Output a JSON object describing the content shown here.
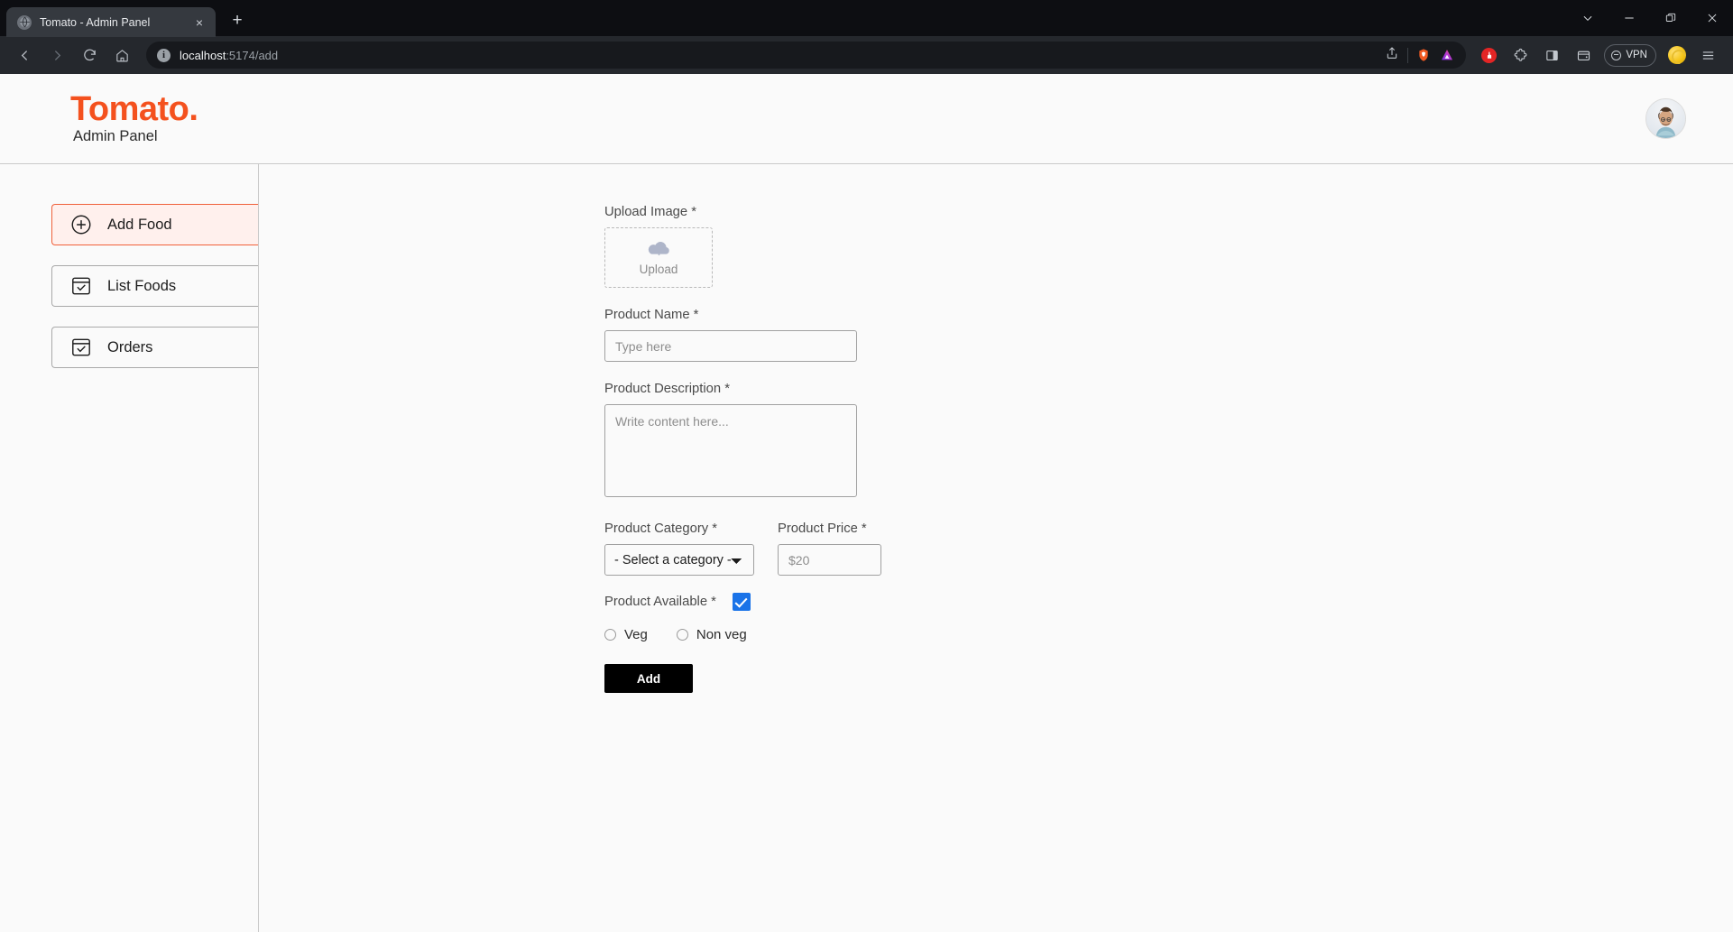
{
  "browser": {
    "tab": {
      "title": "Tomato - Admin Panel",
      "favicon_name": "globe-icon",
      "close_label": "×"
    },
    "new_tab_label": "+",
    "window_controls": [
      "tab-search-chevron",
      "minimize",
      "maximize",
      "close"
    ],
    "nav": {
      "back": "back-arrow",
      "forward": "forward-arrow",
      "reload": "reload-icon",
      "home": "home-icon",
      "bookmark": "bookmark-icon"
    },
    "url": {
      "host": "localhost",
      "path": ":5174/add",
      "full": "localhost:5174/add",
      "info_glyph": "i"
    },
    "url_actions": [
      "share-icon",
      "brave-shields-lion-icon",
      "brave-leo-ai-icon"
    ],
    "toolbar_icons": [
      "brave-rewards-icon",
      "extensions-puzzle-icon",
      "sidebar-panel-icon",
      "brave-wallet-icon"
    ],
    "vpn": {
      "label": "VPN"
    },
    "profile_icon": "browser-profile-avatar",
    "menu_icon": "hamburger-menu-icon"
  },
  "app": {
    "logo": {
      "text": "Tomato.",
      "color": "#f4511e"
    },
    "subtitle": "Admin Panel",
    "avatar_name": "admin-profile-avatar"
  },
  "sidebar": {
    "items": [
      {
        "label": "Add Food",
        "icon": "plus-circle-icon",
        "active": true
      },
      {
        "label": "List Foods",
        "icon": "checkbox-list-icon",
        "active": false
      },
      {
        "label": "Orders",
        "icon": "checkbox-list-icon",
        "active": false
      }
    ],
    "active_colors": {
      "border": "#f0603a",
      "background": "#fff0ed"
    }
  },
  "form": {
    "upload": {
      "label": "Upload Image *",
      "button_text": "Upload",
      "icon": "cloud-upload-icon"
    },
    "product_name": {
      "label": "Product Name *",
      "placeholder": "Type here",
      "value": ""
    },
    "product_description": {
      "label": "Product Description *",
      "placeholder": "Write content here...",
      "value": ""
    },
    "product_category": {
      "label": "Product Category *",
      "selected": "- Select a category -",
      "options": [
        "- Select a category -"
      ]
    },
    "product_price": {
      "label": "Product Price *",
      "placeholder": "$20",
      "value": ""
    },
    "product_available": {
      "label": "Product Available *",
      "checked": true,
      "checkbox_color": "#1a73e8"
    },
    "diet_options": [
      {
        "label": "Veg",
        "selected": false
      },
      {
        "label": "Non veg",
        "selected": false
      }
    ],
    "submit": {
      "label": "Add"
    }
  }
}
